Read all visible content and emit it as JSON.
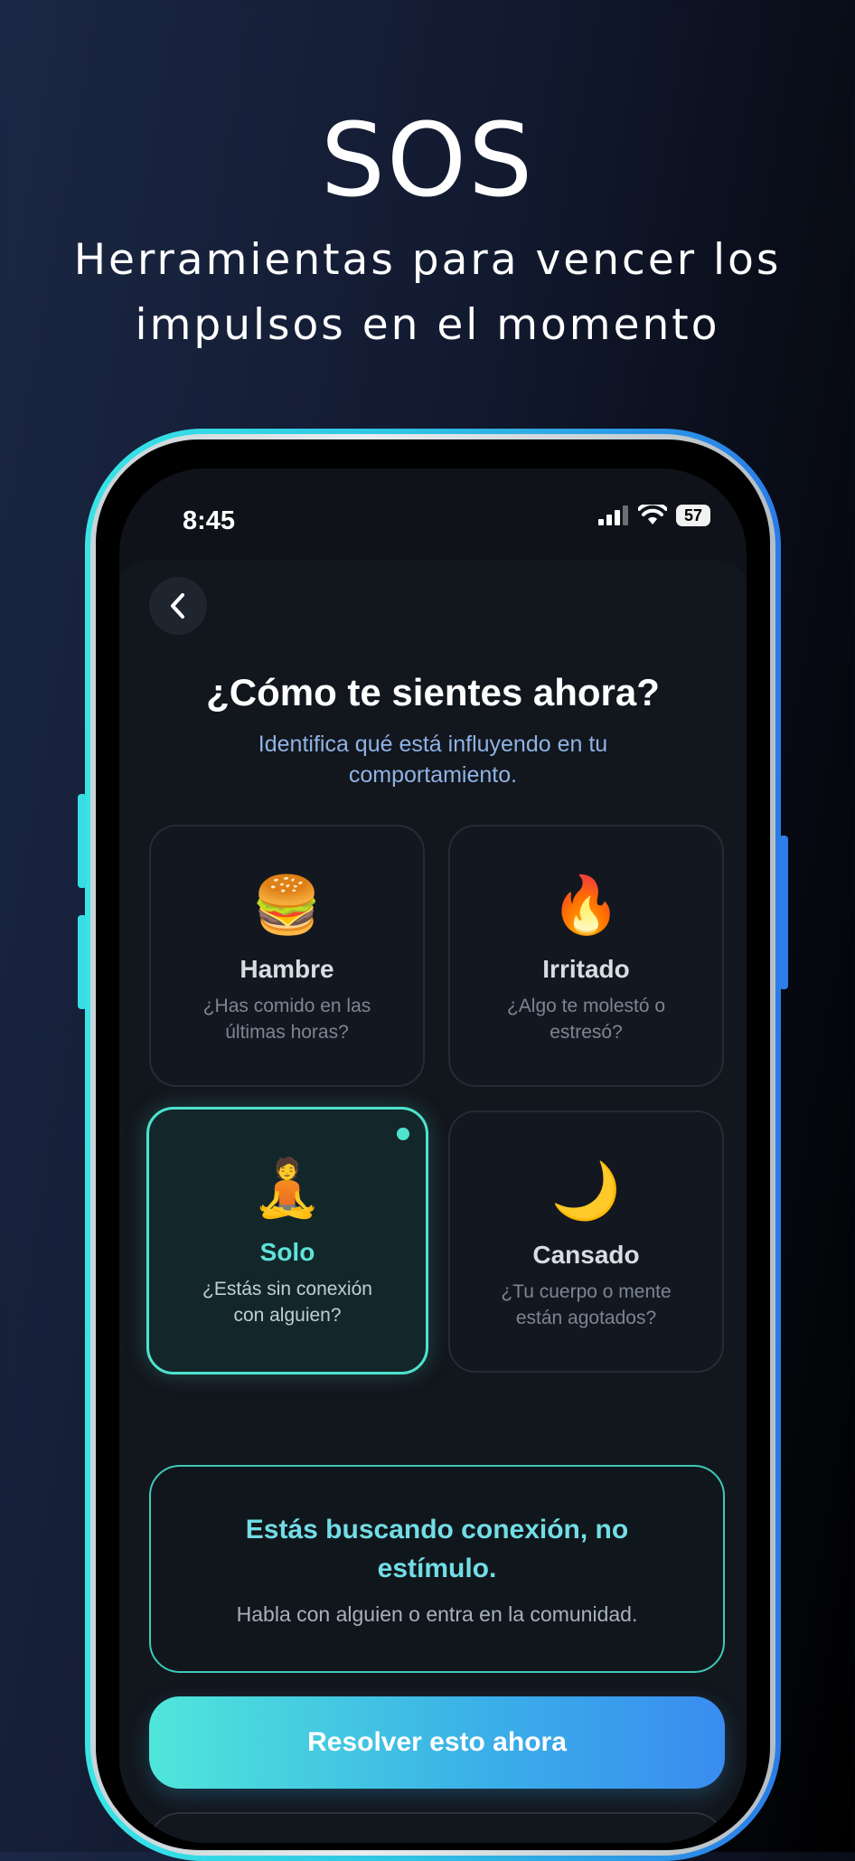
{
  "promo": {
    "title": "SOS",
    "subtitle": "Herramientas para vencer los impulsos en el momento"
  },
  "status_bar": {
    "time": "8:45",
    "battery": "57"
  },
  "screen": {
    "heading": "¿Cómo te sientes ahora?",
    "subheading": "Identifica qué está influyendo en tu comportamiento.",
    "cards": [
      {
        "emoji": "🍔",
        "name": "Hambre",
        "description": "¿Has comido en las últimas horas?",
        "selected": false
      },
      {
        "emoji": "🔥",
        "name": "Irritado",
        "description": "¿Algo te molestó o estresó?",
        "selected": false
      },
      {
        "emoji": "🧘",
        "name": "Solo",
        "description": "¿Estás sin conexión con alguien?",
        "selected": true
      },
      {
        "emoji": "🌙",
        "name": "Cansado",
        "description": "¿Tu cuerpo o mente están agotados?",
        "selected": false
      }
    ],
    "insight": {
      "title": "Estás buscando conexión, no estímulo.",
      "body": "Habla con alguien o entra en la comunidad."
    },
    "primary_button": "Resolver esto ahora"
  },
  "colors": {
    "accent": "#4ee3cc",
    "button_start": "#4fe6da",
    "button_end": "#3a8cf0",
    "subheading": "#8fb3e6"
  }
}
